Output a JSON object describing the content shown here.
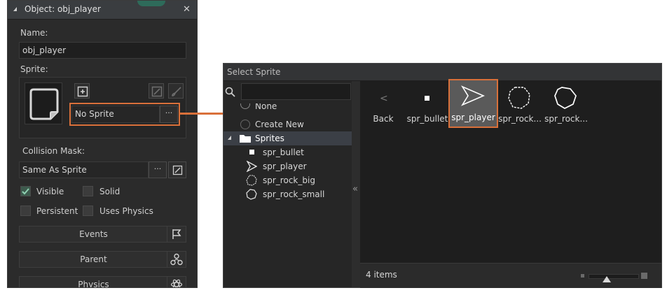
{
  "object_panel": {
    "title": "Object: obj_player",
    "close_glyph": "✕",
    "name_label": "Name:",
    "name_value": "obj_player",
    "sprite_label": "Sprite:",
    "sprite_value": "No Sprite",
    "ellipsis": "···",
    "collision_label": "Collision Mask:",
    "collision_value": "Same As Sprite",
    "checkboxes": [
      {
        "label": "Visible",
        "checked": true
      },
      {
        "label": "Solid",
        "checked": false
      },
      {
        "label": "Persistent",
        "checked": false
      },
      {
        "label": "Uses Physics",
        "checked": false
      }
    ],
    "buttons": {
      "events": "Events",
      "parent": "Parent",
      "physics": "Physics"
    }
  },
  "select_sprite": {
    "title": "Select Sprite",
    "tree": {
      "none": "None",
      "create_new": "Create New",
      "sprites_folder": "Sprites",
      "items": [
        "spr_bullet",
        "spr_player",
        "spr_rock_big",
        "spr_rock_small"
      ]
    },
    "splitter_glyph": "«",
    "grid": {
      "back_glyph": "<",
      "items": [
        "Back",
        "spr_bullet",
        "spr_player",
        "spr_rock...",
        "spr_rock..."
      ]
    },
    "status": "4 items"
  },
  "colors": {
    "highlight": "#d9703a",
    "accent": "#2e6b5a",
    "selection": "#3b3f46"
  }
}
